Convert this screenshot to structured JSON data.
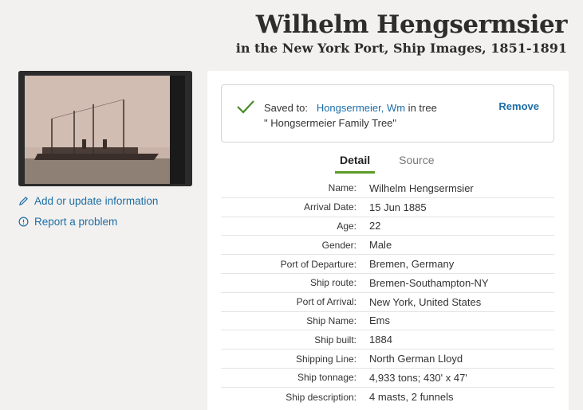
{
  "header": {
    "title": "Wilhelm Hengsermsier",
    "subtitle": "in the New York Port, Ship Images, 1851-1891"
  },
  "side_links": {
    "add_update": "Add or update information",
    "report": "Report a problem"
  },
  "saved": {
    "prefix": "Saved to:",
    "person_link": "Hongsermeier, Wm",
    "middle": " in tree \"",
    "tree_name": "Hongsermeier Family Tree\"",
    "remove_label": "Remove"
  },
  "tabs": [
    {
      "label": "Detail",
      "active": true
    },
    {
      "label": "Source",
      "active": false
    }
  ],
  "details": [
    {
      "label": "Name:",
      "value": "Wilhelm Hengsermsier"
    },
    {
      "label": "Arrival Date:",
      "value": "15 Jun 1885"
    },
    {
      "label": "Age:",
      "value": "22"
    },
    {
      "label": "Gender:",
      "value": "Male"
    },
    {
      "label": "Port of Departure:",
      "value": "Bremen, Germany"
    },
    {
      "label": "Ship route:",
      "value": "Bremen-Southampton-NY"
    },
    {
      "label": "Port of Arrival:",
      "value": "New York, United States"
    },
    {
      "label": "Ship Name:",
      "value": "Ems"
    },
    {
      "label": "Ship built:",
      "value": "1884"
    },
    {
      "label": "Shipping Line:",
      "value": "North German Lloyd"
    },
    {
      "label": "Ship tonnage:",
      "value": "4,933 tons; 430' x 47'"
    },
    {
      "label": "Ship description:",
      "value": "4 masts, 2 funnels"
    }
  ],
  "colors": {
    "accent_link": "#1d6ea6",
    "tab_underline": "#5d9a2a",
    "check": "#4a8a2a"
  }
}
